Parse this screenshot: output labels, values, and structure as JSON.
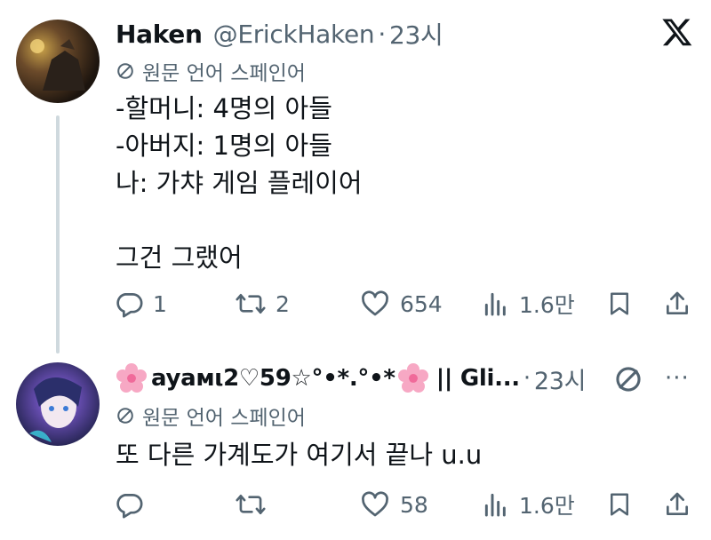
{
  "brand": {
    "logo_text": "X"
  },
  "tweets": [
    {
      "display_name": "Haken",
      "handle": "@ErickHaken",
      "separator": "·",
      "time": "23시",
      "translate_label": "원문 언어 스페인어",
      "text": "-할머니: 4명의 아들\n-아버지: 1명의 아들\n나: 가챠 게임 플레이어\n\n그건 그랬어",
      "replies": "1",
      "reposts": "2",
      "likes": "654",
      "views": "1.6만"
    },
    {
      "display_name": "ayaмι2♡59☆°•*.°•*",
      "display_name_suffix": "|| Gli...",
      "separator": "·",
      "time": "23시",
      "translate_label": "원문 언어 스페인어",
      "text": "또 다른 가계도가 여기서 끝나 u.u",
      "replies": "",
      "reposts": "",
      "likes": "58",
      "views": "1.6만",
      "more_label": "···"
    }
  ],
  "colors": {
    "text": "#0f1419",
    "muted": "#536471",
    "thread_line": "#cfd9de",
    "background": "#ffffff"
  }
}
